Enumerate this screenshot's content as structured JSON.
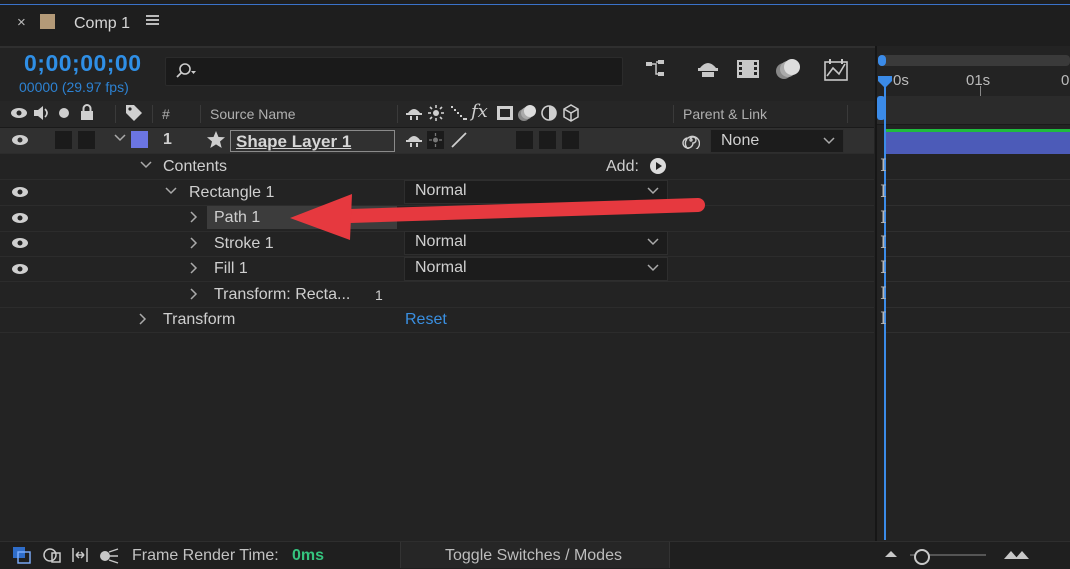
{
  "tab": {
    "title": "Comp 1",
    "close": "×",
    "swatch_color": "#b49a78"
  },
  "timecode": {
    "time": "0;00;00;00",
    "frames": "00000 (29.97 fps)"
  },
  "search": {
    "value": "",
    "placeholder": ""
  },
  "columns": {
    "number": "#",
    "source_name": "Source Name",
    "parent_link": "Parent & Link",
    "add_label": "Add:"
  },
  "layer": {
    "number": "1",
    "name": "Shape Layer 1",
    "color": "#6b75e3",
    "parent": "None"
  },
  "tree": {
    "contents": "Contents",
    "rectangle": "Rectangle 1",
    "path": "Path 1",
    "stroke": "Stroke 1",
    "fill": "Fill 1",
    "transform_rect": "Transform: Recta...",
    "transform_rect_value": "1",
    "transform": "Transform",
    "reset": "Reset",
    "blend_mode": "Normal"
  },
  "ruler": {
    "t0": "0s",
    "t1": "01s",
    "t2": "0"
  },
  "bottom": {
    "render_label": "Frame Render Time:",
    "render_value": "0ms",
    "toggle": "Toggle Switches / Modes"
  },
  "colors": {
    "accent": "#2f8fe6",
    "arrow": "#e6393f",
    "layer_bar": "#4c5bb8",
    "render_time": "#35c37e"
  },
  "icons": [
    "search-icon",
    "close-icon",
    "menu-icon",
    "eye-icon",
    "audio-icon",
    "solo-icon",
    "lock-icon",
    "label-icon",
    "star-icon",
    "shy-icon",
    "collapse-icon",
    "quality-icon",
    "fx-icon",
    "motion-blur-icon",
    "adjustment-icon",
    "3d-icon",
    "parent-spiral-icon",
    "chevron-down-icon",
    "play-circle-icon",
    "red-arrow-icon"
  ]
}
